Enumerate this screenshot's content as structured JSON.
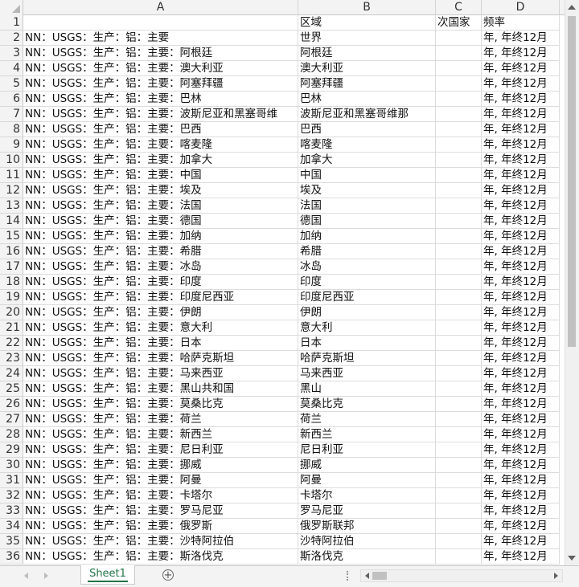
{
  "columns": [
    "A",
    "B",
    "C",
    "D"
  ],
  "rows": [
    {
      "num": "1",
      "a": "",
      "b": "区域",
      "c": "次国家",
      "d": "频率"
    },
    {
      "num": "2",
      "a": "NN：USGS：生产：铝：主要",
      "b": "世界",
      "c": "",
      "d": "年, 年终12月"
    },
    {
      "num": "3",
      "a": "NN：USGS：生产：铝：主要：阿根廷",
      "b": "阿根廷",
      "c": "",
      "d": "年, 年终12月"
    },
    {
      "num": "4",
      "a": "NN：USGS：生产：铝：主要：澳大利亚",
      "b": "澳大利亚",
      "c": "",
      "d": "年, 年终12月"
    },
    {
      "num": "5",
      "a": "NN：USGS：生产：铝：主要：阿塞拜疆",
      "b": "阿塞拜疆",
      "c": "",
      "d": "年, 年终12月"
    },
    {
      "num": "6",
      "a": "NN：USGS：生产：铝：主要：巴林",
      "b": "巴林",
      "c": "",
      "d": "年, 年终12月"
    },
    {
      "num": "7",
      "a": "NN：USGS：生产：铝：主要：波斯尼亚和黑塞哥维",
      "b": "波斯尼亚和黑塞哥维那",
      "c": "",
      "d": "年, 年终12月"
    },
    {
      "num": "8",
      "a": "NN：USGS：生产：铝：主要：巴西",
      "b": "巴西",
      "c": "",
      "d": "年, 年终12月"
    },
    {
      "num": "9",
      "a": "NN：USGS：生产：铝：主要：喀麦隆",
      "b": "喀麦隆",
      "c": "",
      "d": "年, 年终12月"
    },
    {
      "num": "10",
      "a": "NN：USGS：生产：铝：主要：加拿大",
      "b": "加拿大",
      "c": "",
      "d": "年, 年终12月"
    },
    {
      "num": "11",
      "a": "NN：USGS：生产：铝：主要：中国",
      "b": "中国",
      "c": "",
      "d": "年, 年终12月"
    },
    {
      "num": "12",
      "a": "NN：USGS：生产：铝：主要：埃及",
      "b": "埃及",
      "c": "",
      "d": "年, 年终12月"
    },
    {
      "num": "13",
      "a": "NN：USGS：生产：铝：主要：法国",
      "b": "法国",
      "c": "",
      "d": "年, 年终12月"
    },
    {
      "num": "14",
      "a": "NN：USGS：生产：铝：主要：德国",
      "b": "德国",
      "c": "",
      "d": "年, 年终12月"
    },
    {
      "num": "15",
      "a": "NN：USGS：生产：铝：主要：加纳",
      "b": "加纳",
      "c": "",
      "d": "年, 年终12月"
    },
    {
      "num": "16",
      "a": "NN：USGS：生产：铝：主要：希腊",
      "b": "希腊",
      "c": "",
      "d": "年, 年终12月"
    },
    {
      "num": "17",
      "a": "NN：USGS：生产：铝：主要：冰岛",
      "b": "冰岛",
      "c": "",
      "d": "年, 年终12月"
    },
    {
      "num": "18",
      "a": "NN：USGS：生产：铝：主要：印度",
      "b": "印度",
      "c": "",
      "d": "年, 年终12月"
    },
    {
      "num": "19",
      "a": "NN：USGS：生产：铝：主要：印度尼西亚",
      "b": "印度尼西亚",
      "c": "",
      "d": "年, 年终12月"
    },
    {
      "num": "20",
      "a": "NN：USGS：生产：铝：主要：伊朗",
      "b": "伊朗",
      "c": "",
      "d": "年, 年终12月"
    },
    {
      "num": "21",
      "a": "NN：USGS：生产：铝：主要：意大利",
      "b": "意大利",
      "c": "",
      "d": "年, 年终12月"
    },
    {
      "num": "22",
      "a": "NN：USGS：生产：铝：主要：日本",
      "b": "日本",
      "c": "",
      "d": "年, 年终12月"
    },
    {
      "num": "23",
      "a": "NN：USGS：生产：铝：主要：哈萨克斯坦",
      "b": "哈萨克斯坦",
      "c": "",
      "d": "年, 年终12月"
    },
    {
      "num": "24",
      "a": "NN：USGS：生产：铝：主要：马来西亚",
      "b": "马来西亚",
      "c": "",
      "d": "年, 年终12月"
    },
    {
      "num": "25",
      "a": "NN：USGS：生产：铝：主要：黑山共和国",
      "b": "黑山",
      "c": "",
      "d": "年, 年终12月"
    },
    {
      "num": "26",
      "a": "NN：USGS：生产：铝：主要：莫桑比克",
      "b": "莫桑比克",
      "c": "",
      "d": "年, 年终12月"
    },
    {
      "num": "27",
      "a": "NN：USGS：生产：铝：主要：荷兰",
      "b": "荷兰",
      "c": "",
      "d": "年, 年终12月"
    },
    {
      "num": "28",
      "a": "NN：USGS：生产：铝：主要：新西兰",
      "b": "新西兰",
      "c": "",
      "d": "年, 年终12月"
    },
    {
      "num": "29",
      "a": "NN：USGS：生产：铝：主要：尼日利亚",
      "b": "尼日利亚",
      "c": "",
      "d": "年, 年终12月"
    },
    {
      "num": "30",
      "a": "NN：USGS：生产：铝：主要：挪威",
      "b": "挪威",
      "c": "",
      "d": "年, 年终12月"
    },
    {
      "num": "31",
      "a": "NN：USGS：生产：铝：主要：阿曼",
      "b": "阿曼",
      "c": "",
      "d": "年, 年终12月"
    },
    {
      "num": "32",
      "a": "NN：USGS：生产：铝：主要：卡塔尔",
      "b": "卡塔尔",
      "c": "",
      "d": "年, 年终12月"
    },
    {
      "num": "33",
      "a": "NN：USGS：生产：铝：主要：罗马尼亚",
      "b": "罗马尼亚",
      "c": "",
      "d": "年, 年终12月"
    },
    {
      "num": "34",
      "a": "NN：USGS：生产：铝：主要：俄罗斯",
      "b": "俄罗斯联邦",
      "c": "",
      "d": "年, 年终12月"
    },
    {
      "num": "35",
      "a": "NN：USGS：生产：铝：主要：沙特阿拉伯",
      "b": "沙特阿拉伯",
      "c": "",
      "d": "年, 年终12月"
    },
    {
      "num": "36",
      "a": "NN：USGS：生产：铝：主要：斯洛伐克",
      "b": "斯洛伐克",
      "c": "",
      "d": "年, 年终12月"
    }
  ],
  "tabs": {
    "sheet": "Sheet1",
    "add": "+"
  }
}
